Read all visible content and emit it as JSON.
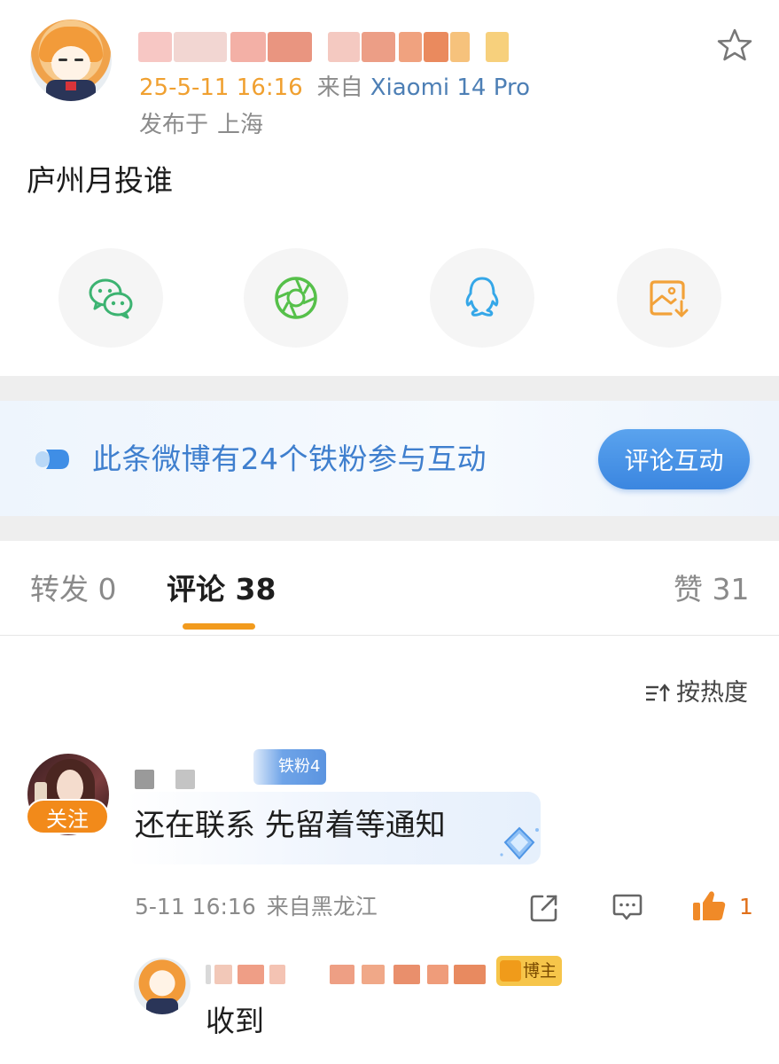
{
  "post": {
    "time": "25-5-11 16:16",
    "from_label": "来自",
    "device": "Xiaomi 14 Pro",
    "location_label": "发布于",
    "location": "上海",
    "text": "庐州月投谁"
  },
  "share": {
    "items": [
      "wechat-icon",
      "moments-icon",
      "qq-icon",
      "save-image-icon"
    ]
  },
  "fan_banner": {
    "text": "此条微博有24个铁粉参与互动",
    "button_label": "评论互动"
  },
  "tabs": {
    "repost": "转发 0",
    "comment": "评论 38",
    "like": "赞 31"
  },
  "sort": {
    "label": "按热度"
  },
  "comment": {
    "follow_label": "关注",
    "badge": "铁粉4",
    "text": "还在联系 先留着等通知",
    "time": "5-11 16:16",
    "location": "来自黑龙江",
    "like_count": "1"
  },
  "reply": {
    "badge": "博主",
    "text": "收到"
  },
  "colors": {
    "accent_orange": "#f29b1e",
    "link_blue": "#4d7fb5",
    "fan_blue": "#3f7fce"
  }
}
